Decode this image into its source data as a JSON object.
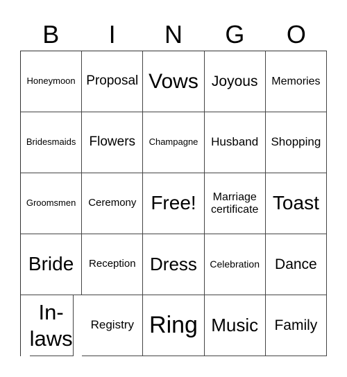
{
  "header": [
    "B",
    "I",
    "N",
    "G",
    "O"
  ],
  "cells": [
    [
      "Honeymoon",
      "Proposal",
      "Vows",
      "Joyous",
      "Memories"
    ],
    [
      "Bridesmaids",
      "Flowers",
      "Champagne",
      "Husband",
      "Shopping"
    ],
    [
      "Groomsmen",
      "Ceremony",
      "Free!",
      "Marriage certificate",
      "Toast"
    ],
    [
      "Bride",
      "Reception",
      "Dress",
      "Celebration",
      "Dance"
    ],
    [
      "In-laws",
      "Registry",
      "Ring",
      "Music",
      "Family"
    ]
  ]
}
